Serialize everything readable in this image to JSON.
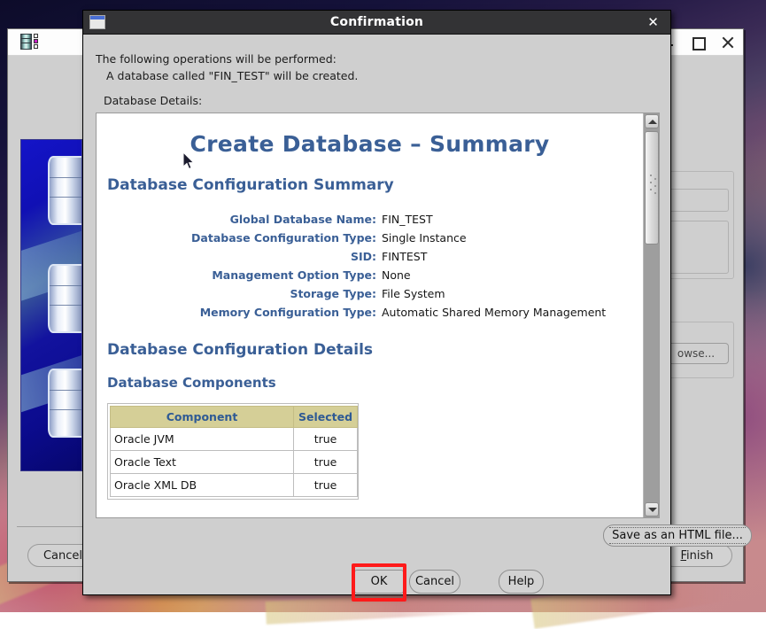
{
  "desktop": {
    "wallpaper_name": "abstract-wallpaper"
  },
  "background_window": {
    "title": "",
    "app_icon": "database-icon",
    "controls": [
      {
        "name": "minimize-button",
        "icon": "minimize-icon"
      },
      {
        "name": "maximize-button",
        "icon": "maximize-icon"
      },
      {
        "name": "close-button",
        "icon": "close-icon"
      }
    ],
    "browse_button_label": "owse...",
    "cancel_button_label": "Cancel",
    "finish_button_label": "inish",
    "finish_button_mnemonic": "F"
  },
  "dialog": {
    "title": "Confirmation",
    "icon": "window-icon",
    "close_icon": "✕",
    "operations_heading": "The following operations will be performed:",
    "operation_item": "A database called \"FIN_TEST\" will be created.",
    "details_label": "Database Details:",
    "buttons": {
      "ok": "OK",
      "cancel": "Cancel",
      "help": "Help",
      "save_html": "Save as an HTML file..."
    },
    "highlight_color": "#ff1a1a",
    "highlighted_button": "ok"
  },
  "summary": {
    "doc_title": "Create Database – Summary",
    "section_config_summary": "Database Configuration Summary",
    "config_rows": [
      {
        "label": "Global Database Name:",
        "value": "FIN_TEST"
      },
      {
        "label": "Database Configuration Type:",
        "value": "Single Instance"
      },
      {
        "label": "SID:",
        "value": "FINTEST"
      },
      {
        "label": "Management Option Type:",
        "value": "None"
      },
      {
        "label": "Storage Type:",
        "value": "File System"
      },
      {
        "label": "Memory Configuration Type:",
        "value": "Automatic Shared Memory Management"
      }
    ],
    "section_config_details": "Database Configuration Details",
    "section_components": "Database Components",
    "components_table": {
      "columns": [
        "Component",
        "Selected"
      ],
      "rows": [
        [
          "Oracle JVM",
          "true"
        ],
        [
          "Oracle Text",
          "true"
        ],
        [
          "Oracle XML DB",
          "true"
        ]
      ]
    },
    "heading_color": "#3a5f96",
    "table_header_bg": "#d5cf97"
  },
  "scrollbar": {
    "up_arrow": "scroll-up-arrow",
    "down_arrow": "scroll-down-arrow",
    "thumb": "scroll-thumb"
  }
}
